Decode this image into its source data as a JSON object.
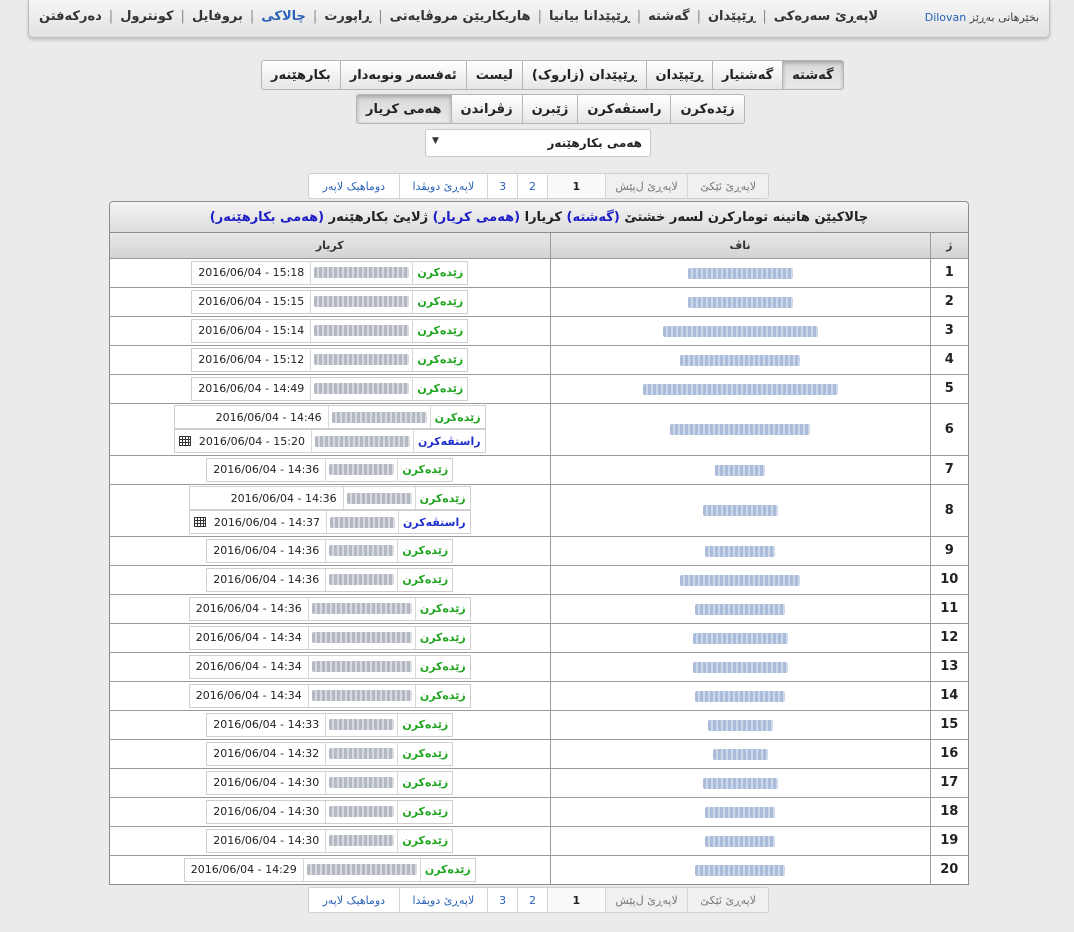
{
  "nav": {
    "greeting": "بخێرهاتی بەڕێز",
    "user": "Dilovan",
    "items": [
      {
        "label": "لاپەڕێ سەرەکی",
        "active": false
      },
      {
        "label": "ڕێپێدان",
        "active": false
      },
      {
        "label": "گەشتە",
        "active": false
      },
      {
        "label": "ڕێپێدانا بیانیا",
        "active": false
      },
      {
        "label": "هاریکاریێن مروڤایەتی",
        "active": false
      },
      {
        "label": "ڕاپورت",
        "active": false
      },
      {
        "label": "چالاکی",
        "active": true
      },
      {
        "label": "بروفایل",
        "active": false
      },
      {
        "label": "کونترول",
        "active": false
      },
      {
        "label": "دەرکەفتن",
        "active": false
      }
    ]
  },
  "tabs_row1": [
    {
      "label": "گەشتە",
      "active": true
    },
    {
      "label": "گەشتیار",
      "active": false
    },
    {
      "label": "ڕێپێدان",
      "active": false
    },
    {
      "label": "ڕێپێدان (زاروک)",
      "active": false
    },
    {
      "label": "لیست",
      "active": false
    },
    {
      "label": "ئەفسەر ونوبەدار",
      "active": false
    },
    {
      "label": "بکارهێنەر",
      "active": false
    }
  ],
  "tabs_row2": [
    {
      "label": "زێدەکرن",
      "active": false
    },
    {
      "label": "راستڤەکرن",
      "active": false
    },
    {
      "label": "ژێبرن",
      "active": false
    },
    {
      "label": "زڤراندن",
      "active": false
    },
    {
      "label": "هەمی کریار",
      "active": true
    }
  ],
  "user_select": {
    "value": "هەمی بکارهێنەر"
  },
  "pagination": {
    "first": "لاپەڕێ ئێکێ",
    "prev": "لاپەڕێ ل‌پێش",
    "pages": [
      "1",
      "2",
      "3"
    ],
    "current": "1",
    "next": "لاپەڕێ دویڤدا",
    "last": "دوماهیک لاپەر"
  },
  "panel": {
    "title_a": "چالاکیێن هاتینە تومارکرن لسەر خشتێ",
    "title_b": "(گەشتە)",
    "title_c": "کریارا",
    "title_d": "(هەمی کریار)",
    "title_e": "ژلایێ بکارهێنەر",
    "title_f": "(هەمی بکارهێنەر)"
  },
  "columns": {
    "num": "ژ",
    "name": "ناڤ",
    "action": "کریار"
  },
  "labels": {
    "add": "زێدەکرن",
    "edit": "راستڤەکرن"
  },
  "rows": [
    {
      "n": "1",
      "acts": [
        {
          "t": "add",
          "d": "2016/06/04 - 15:18"
        }
      ]
    },
    {
      "n": "2",
      "acts": [
        {
          "t": "add",
          "d": "2016/06/04 - 15:15"
        }
      ]
    },
    {
      "n": "3",
      "acts": [
        {
          "t": "add",
          "d": "2016/06/04 - 15:14"
        }
      ]
    },
    {
      "n": "4",
      "acts": [
        {
          "t": "add",
          "d": "2016/06/04 - 15:12"
        }
      ]
    },
    {
      "n": "5",
      "acts": [
        {
          "t": "add",
          "d": "2016/06/04 - 14:49"
        }
      ]
    },
    {
      "n": "6",
      "acts": [
        {
          "t": "add",
          "d": "2016/06/04 - 14:46"
        },
        {
          "t": "edit",
          "d": "2016/06/04 - 15:20"
        }
      ]
    },
    {
      "n": "7",
      "acts": [
        {
          "t": "add",
          "d": "2016/06/04 - 14:36"
        }
      ]
    },
    {
      "n": "8",
      "acts": [
        {
          "t": "add",
          "d": "2016/06/04 - 14:36"
        },
        {
          "t": "edit",
          "d": "2016/06/04 - 14:37"
        }
      ]
    },
    {
      "n": "9",
      "acts": [
        {
          "t": "add",
          "d": "2016/06/04 - 14:36"
        }
      ]
    },
    {
      "n": "10",
      "acts": [
        {
          "t": "add",
          "d": "2016/06/04 - 14:36"
        }
      ]
    },
    {
      "n": "11",
      "acts": [
        {
          "t": "add",
          "d": "2016/06/04 - 14:36"
        }
      ]
    },
    {
      "n": "12",
      "acts": [
        {
          "t": "add",
          "d": "2016/06/04 - 14:34"
        }
      ]
    },
    {
      "n": "13",
      "acts": [
        {
          "t": "add",
          "d": "2016/06/04 - 14:34"
        }
      ]
    },
    {
      "n": "14",
      "acts": [
        {
          "t": "add",
          "d": "2016/06/04 - 14:34"
        }
      ]
    },
    {
      "n": "15",
      "acts": [
        {
          "t": "add",
          "d": "2016/06/04 - 14:33"
        }
      ]
    },
    {
      "n": "16",
      "acts": [
        {
          "t": "add",
          "d": "2016/06/04 - 14:32"
        }
      ]
    },
    {
      "n": "17",
      "acts": [
        {
          "t": "add",
          "d": "2016/06/04 - 14:30"
        }
      ]
    },
    {
      "n": "18",
      "acts": [
        {
          "t": "add",
          "d": "2016/06/04 - 14:30"
        }
      ]
    },
    {
      "n": "19",
      "acts": [
        {
          "t": "add",
          "d": "2016/06/04 - 14:30"
        }
      ]
    },
    {
      "n": "20",
      "acts": [
        {
          "t": "add",
          "d": "2016/06/04 - 14:29"
        }
      ]
    }
  ],
  "colors": {
    "link": "#2a62b8",
    "add": "#1ea51e",
    "edit": "#1e2ed0",
    "highlight": "#1e1ec8"
  }
}
